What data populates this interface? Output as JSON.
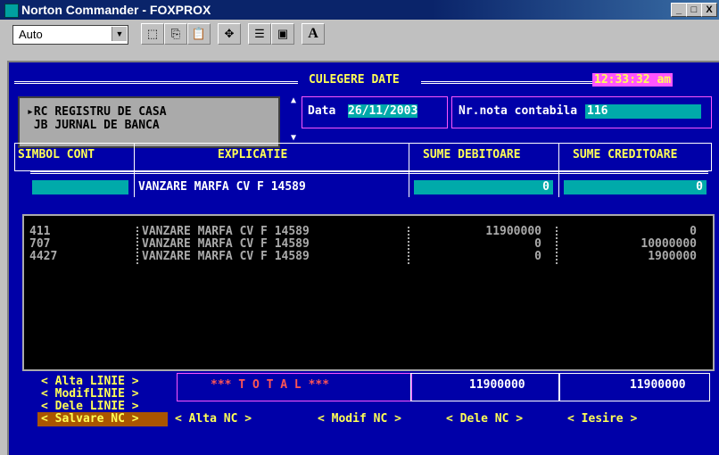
{
  "window": {
    "title": "Norton Commander - FOXPROX",
    "controls": [
      "_",
      "□",
      "X"
    ]
  },
  "toolbar": {
    "font_combo_value": "Auto",
    "buttons": [
      "select-icon",
      "copy-icon",
      "paste-icon",
      "move-icon",
      "properties-icon",
      "window-icon",
      "font-icon"
    ],
    "font_btn_label": "A"
  },
  "screen": {
    "section_title": "CULEGERE DATE",
    "clock": "12:33:32 am",
    "register_menu": [
      {
        "code": "RC",
        "label": "REGISTRU DE CASA",
        "selected": true
      },
      {
        "code": "JB",
        "label": "JURNAL DE BANCA",
        "selected": false
      }
    ],
    "date_label": "Data",
    "date_value": "26/11/2003",
    "nota_label": "Nr.nota contabila",
    "nota_value": "116",
    "columns": {
      "simbol": "SIMBOL CONT",
      "explicatie": "EXPLICATIE",
      "debit": "SUME DEBITOARE",
      "credit": "SUME CREDITOARE"
    },
    "input_row": {
      "simbol": "",
      "explicatie": "VANZARE MARFA CV F 14589",
      "debit": "0",
      "credit": "0"
    },
    "rows": [
      {
        "cont": "411",
        "explicatie": "VANZARE MARFA CV F 14589",
        "debit": "11900000",
        "credit": "0"
      },
      {
        "cont": "707",
        "explicatie": "VANZARE MARFA CV F 14589",
        "debit": "0",
        "credit": "10000000"
      },
      {
        "cont": "4427",
        "explicatie": "VANZARE MARFA CV F 14589",
        "debit": "0",
        "credit": "1900000"
      }
    ],
    "total_label": "*** T O T A L ***",
    "total_debit": "11900000",
    "total_credit": "11900000",
    "line_buttons": [
      "< Alta LINIE >",
      "< ModifLINIE >",
      "< Dele LINIE >"
    ],
    "bottom_buttons": [
      "< Salvare NC >",
      "< Alta NC >",
      "< Modif NC >",
      "< Dele NC >",
      "< Iesire >"
    ]
  },
  "colors": {
    "screen_bg": "#0000a8",
    "yellow": "#ffff55",
    "cyan": "#00aaaa",
    "magenta": "#ff55ff",
    "selected_btn": "#aa5500"
  }
}
